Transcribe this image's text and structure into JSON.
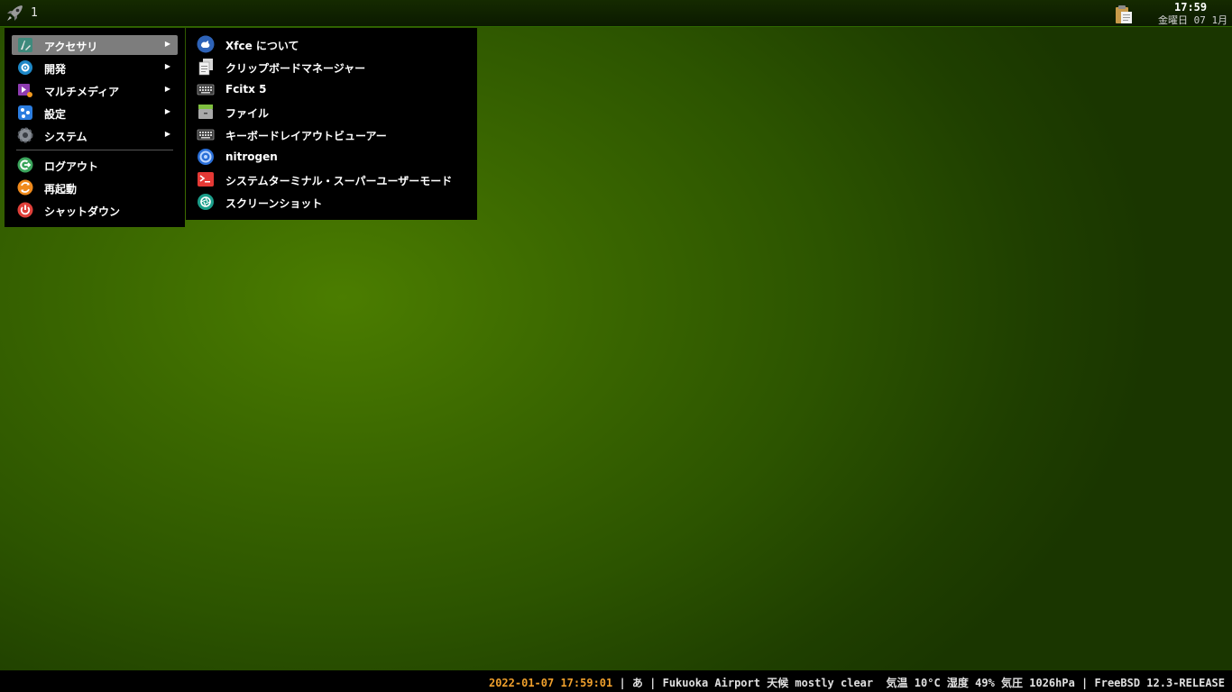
{
  "top_panel": {
    "workspace": "1",
    "clock_time": "17:59",
    "clock_date": "金曜日 07 1月"
  },
  "main_menu": {
    "items": [
      {
        "label": "アクセサリ",
        "icon": "accessories-icon",
        "submenu": true
      },
      {
        "label": "開発",
        "icon": "development-icon",
        "submenu": true
      },
      {
        "label": "マルチメディア",
        "icon": "multimedia-icon",
        "submenu": true
      },
      {
        "label": "設定",
        "icon": "settings-icon",
        "submenu": true
      },
      {
        "label": "システム",
        "icon": "system-icon",
        "submenu": true
      },
      {
        "label": "ログアウト",
        "icon": "logout-icon",
        "submenu": false
      },
      {
        "label": "再起動",
        "icon": "restart-icon",
        "submenu": false
      },
      {
        "label": "シャットダウン",
        "icon": "shutdown-icon",
        "submenu": false
      }
    ],
    "arrow": "▶"
  },
  "sub_menu": {
    "items": [
      {
        "label": "Xfce について",
        "icon": "xfce-icon"
      },
      {
        "label": "クリップボードマネージャー",
        "icon": "clipboard-icon"
      },
      {
        "label": "Fcitx 5",
        "icon": "keyboard-icon"
      },
      {
        "label": "ファイル",
        "icon": "file-manager-icon"
      },
      {
        "label": "キーボードレイアウトビューアー",
        "icon": "keyboard-layout-icon"
      },
      {
        "label": "nitrogen",
        "icon": "nitrogen-icon"
      },
      {
        "label": "システムターミナル・スーパーユーザーモード",
        "icon": "terminal-icon"
      },
      {
        "label": "スクリーンショット",
        "icon": "screenshot-icon"
      }
    ]
  },
  "status_bar": {
    "datetime": "2022-01-07 17:59:01",
    "rest": " | あ | Fukuoka Airport 天候 mostly clear  気温 10°C 湿度 49% 気圧 1026hPa | FreeBSD 12.3-RELEASE"
  },
  "colors": {
    "accent_orange": "#f0a02c",
    "menu_highlight": "#7d7d7d",
    "panel_border": "#2f6a00"
  }
}
